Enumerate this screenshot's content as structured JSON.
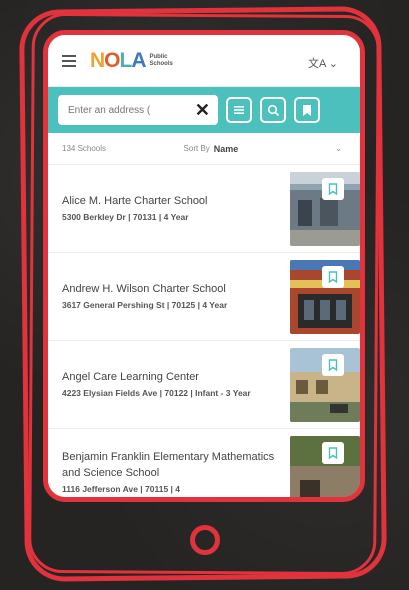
{
  "header": {
    "logo_text": "NOLA",
    "logo_sub": "Public Schools",
    "translate_label": "文A",
    "translate_chevron": "⌄"
  },
  "search": {
    "placeholder": "Enter an address (",
    "clear_label": "✕"
  },
  "sort": {
    "count": "134 Schools",
    "label": "Sort By",
    "value": "Name",
    "chevron": "⌄"
  },
  "schools": [
    {
      "name": "Alice M. Harte Charter School",
      "meta": "5300 Berkley Dr | 70131 | 4 Year"
    },
    {
      "name": "Andrew H. Wilson Charter School",
      "meta": "3617 General Pershing St | 70125 | 4 Year"
    },
    {
      "name": "Angel Care Learning Center",
      "meta": "4223 Elysian Fields Ave | 70122 | Infant - 3 Year"
    },
    {
      "name": "Benjamin Franklin Elementary Mathematics and Science School",
      "meta": "1116 Jefferson Ave | 70115 | 4"
    }
  ],
  "colors": {
    "accent_teal": "#4cc0bd",
    "frame_red": "#e2323c"
  }
}
